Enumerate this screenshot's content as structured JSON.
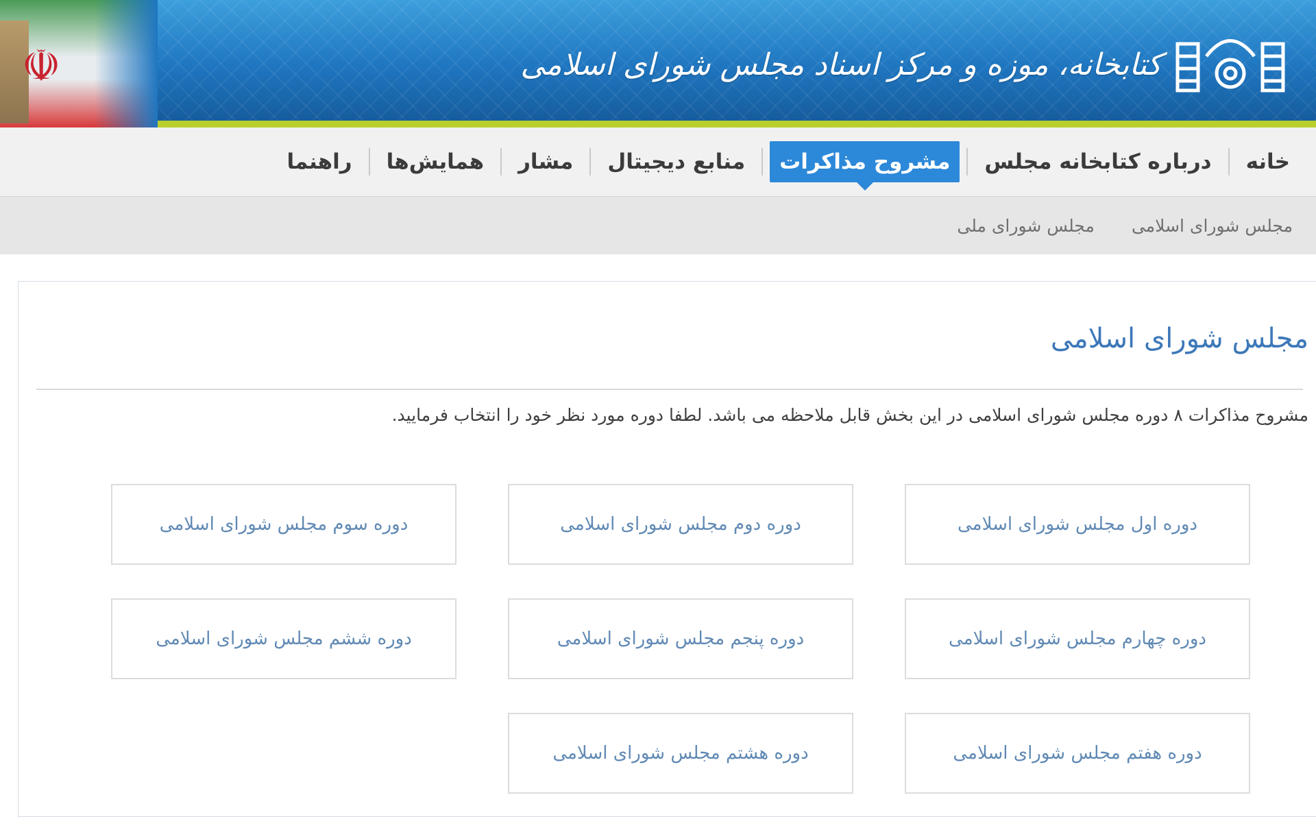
{
  "header": {
    "logo_text": "کتابخانه، موزه و مرکز اسناد مجلس شورای اسلامی",
    "flag_emblem": "الله"
  },
  "nav": {
    "items": [
      {
        "label": "خانه"
      },
      {
        "label": "درباره کتابخانه مجلس"
      },
      {
        "label": "مشروح مذاکرات",
        "active": true
      },
      {
        "label": "منابع دیجیتال"
      },
      {
        "label": "مشار"
      },
      {
        "label": "همایش‌ها"
      },
      {
        "label": "راهنما"
      }
    ]
  },
  "subnav": {
    "items": [
      {
        "label": "مجلس شورای اسلامی"
      },
      {
        "label": "مجلس شورای ملی"
      }
    ]
  },
  "main": {
    "title": "مجلس شورای اسلامی",
    "intro": "مشروح مذاکرات ۸ دوره مجلس شورای اسلامی در این بخش قابل ملاحظه می باشد. لطفا دوره مورد نظر خود را انتخاب فرمایید.",
    "periods": [
      {
        "label": "دوره اول مجلس شورای اسلامی"
      },
      {
        "label": "دوره دوم مجلس شورای اسلامی"
      },
      {
        "label": "دوره سوم مجلس شورای اسلامی"
      },
      {
        "label": "دوره چهارم مجلس شورای اسلامی"
      },
      {
        "label": "دوره پنجم مجلس شورای اسلامی"
      },
      {
        "label": "دوره ششم مجلس شورای اسلامی"
      },
      {
        "label": "دوره هفتم مجلس شورای اسلامی"
      },
      {
        "label": "دوره هشتم مجلس شورای اسلامی"
      }
    ]
  },
  "colors": {
    "accent": "#2c88d9",
    "title": "#3d78b8",
    "link": "#6089b4",
    "banner": "#1f76c0",
    "banner_stripe": "#b9cf2e"
  }
}
